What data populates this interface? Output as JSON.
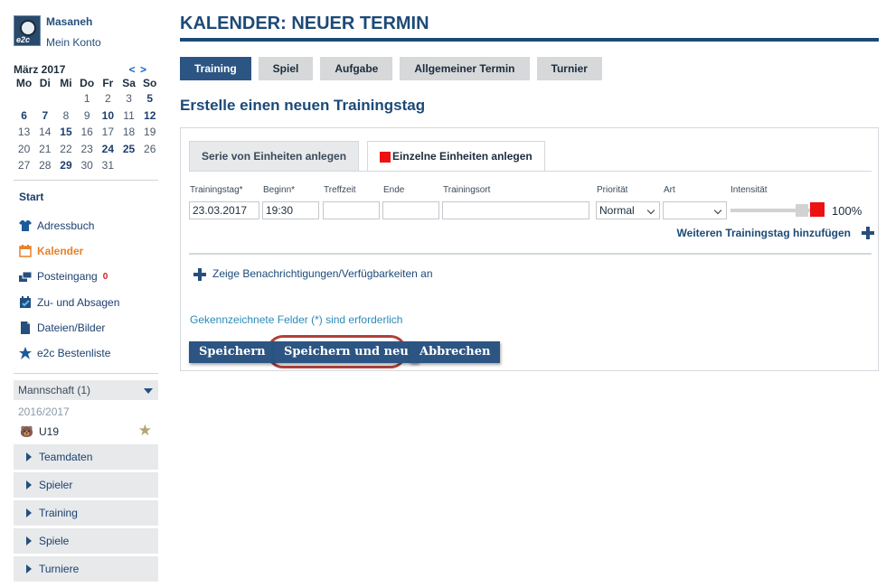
{
  "user": {
    "name": "Masaneh",
    "account": "Mein Konto",
    "avatar_tag": "e2c"
  },
  "calendar": {
    "month": "März 2017",
    "nav": "< >",
    "day_names": [
      "Mo",
      "Di",
      "Mi",
      "Do",
      "Fr",
      "Sa",
      "So"
    ],
    "weeks": [
      [
        "",
        "",
        "",
        "1",
        "2",
        "3",
        "5"
      ],
      [
        "6",
        "7",
        "8",
        "9",
        "10",
        "11",
        "12"
      ],
      [
        "13",
        "14",
        "15",
        "16",
        "17",
        "18",
        "19"
      ],
      [
        "20",
        "21",
        "22",
        "23",
        "24",
        "25",
        "26"
      ],
      [
        "27",
        "28",
        "29",
        "30",
        "31",
        "",
        ""
      ]
    ]
  },
  "nav": {
    "start": "Start",
    "items": [
      {
        "label": "Adressbuch",
        "icon": "shirt-icon"
      },
      {
        "label": "Kalender",
        "icon": "calendar-icon",
        "active": true
      },
      {
        "label": "Posteingang",
        "icon": "inbox-icon",
        "badge": "0"
      },
      {
        "label": "Zu- und Absagen",
        "icon": "check-calendar-icon"
      },
      {
        "label": "Dateien/Bilder",
        "icon": "file-icon"
      },
      {
        "label": "e2c Bestenliste",
        "icon": "star-icon"
      }
    ]
  },
  "team": {
    "header": "Mannschaft (1)",
    "season": "2016/2017",
    "name": "U19",
    "sub_items": [
      "Teamdaten",
      "Spieler",
      "Training",
      "Spiele",
      "Turniere"
    ]
  },
  "main": {
    "title": "KALENDER: NEUER TERMIN",
    "tabs": [
      "Training",
      "Spiel",
      "Aufgabe",
      "Allgemeiner Termin",
      "Turnier"
    ],
    "subtitle": "Erstelle einen neuen Trainingstag",
    "panel_tabs": [
      "Serie von Einheiten anlegen",
      "Einzelne Einheiten anlegen"
    ],
    "fields": {
      "trainingstag_label": "Trainingstag*",
      "trainingstag_value": "23.03.2017",
      "beginn_label": "Beginn*",
      "beginn_value": "19:30",
      "treffzeit_label": "Treffzeit",
      "ende_label": "Ende",
      "trainingsort_label": "Trainingsort",
      "prioritaet_label": "Priorität",
      "prioritaet_value": "Normal",
      "art_label": "Art",
      "intensitaet_label": "Intensität",
      "intensitaet_value": "100%"
    },
    "intensity_level": 1.0,
    "add_day": "Weiteren Trainingstag hinzufügen",
    "notifications": "Zeige Benachrichtigungen/Verfügbarkeiten an",
    "required_note": "Gekennzeichnete Felder (*) sind erforderlich",
    "buttons": {
      "save": "Speichern",
      "save_new": "Speichern und neu",
      "cancel": "Abbrechen"
    }
  },
  "colors": {
    "primary": "#2c5583",
    "accent": "#e8802a",
    "highlight": "#b0403a",
    "intensity": "#ee1111"
  }
}
